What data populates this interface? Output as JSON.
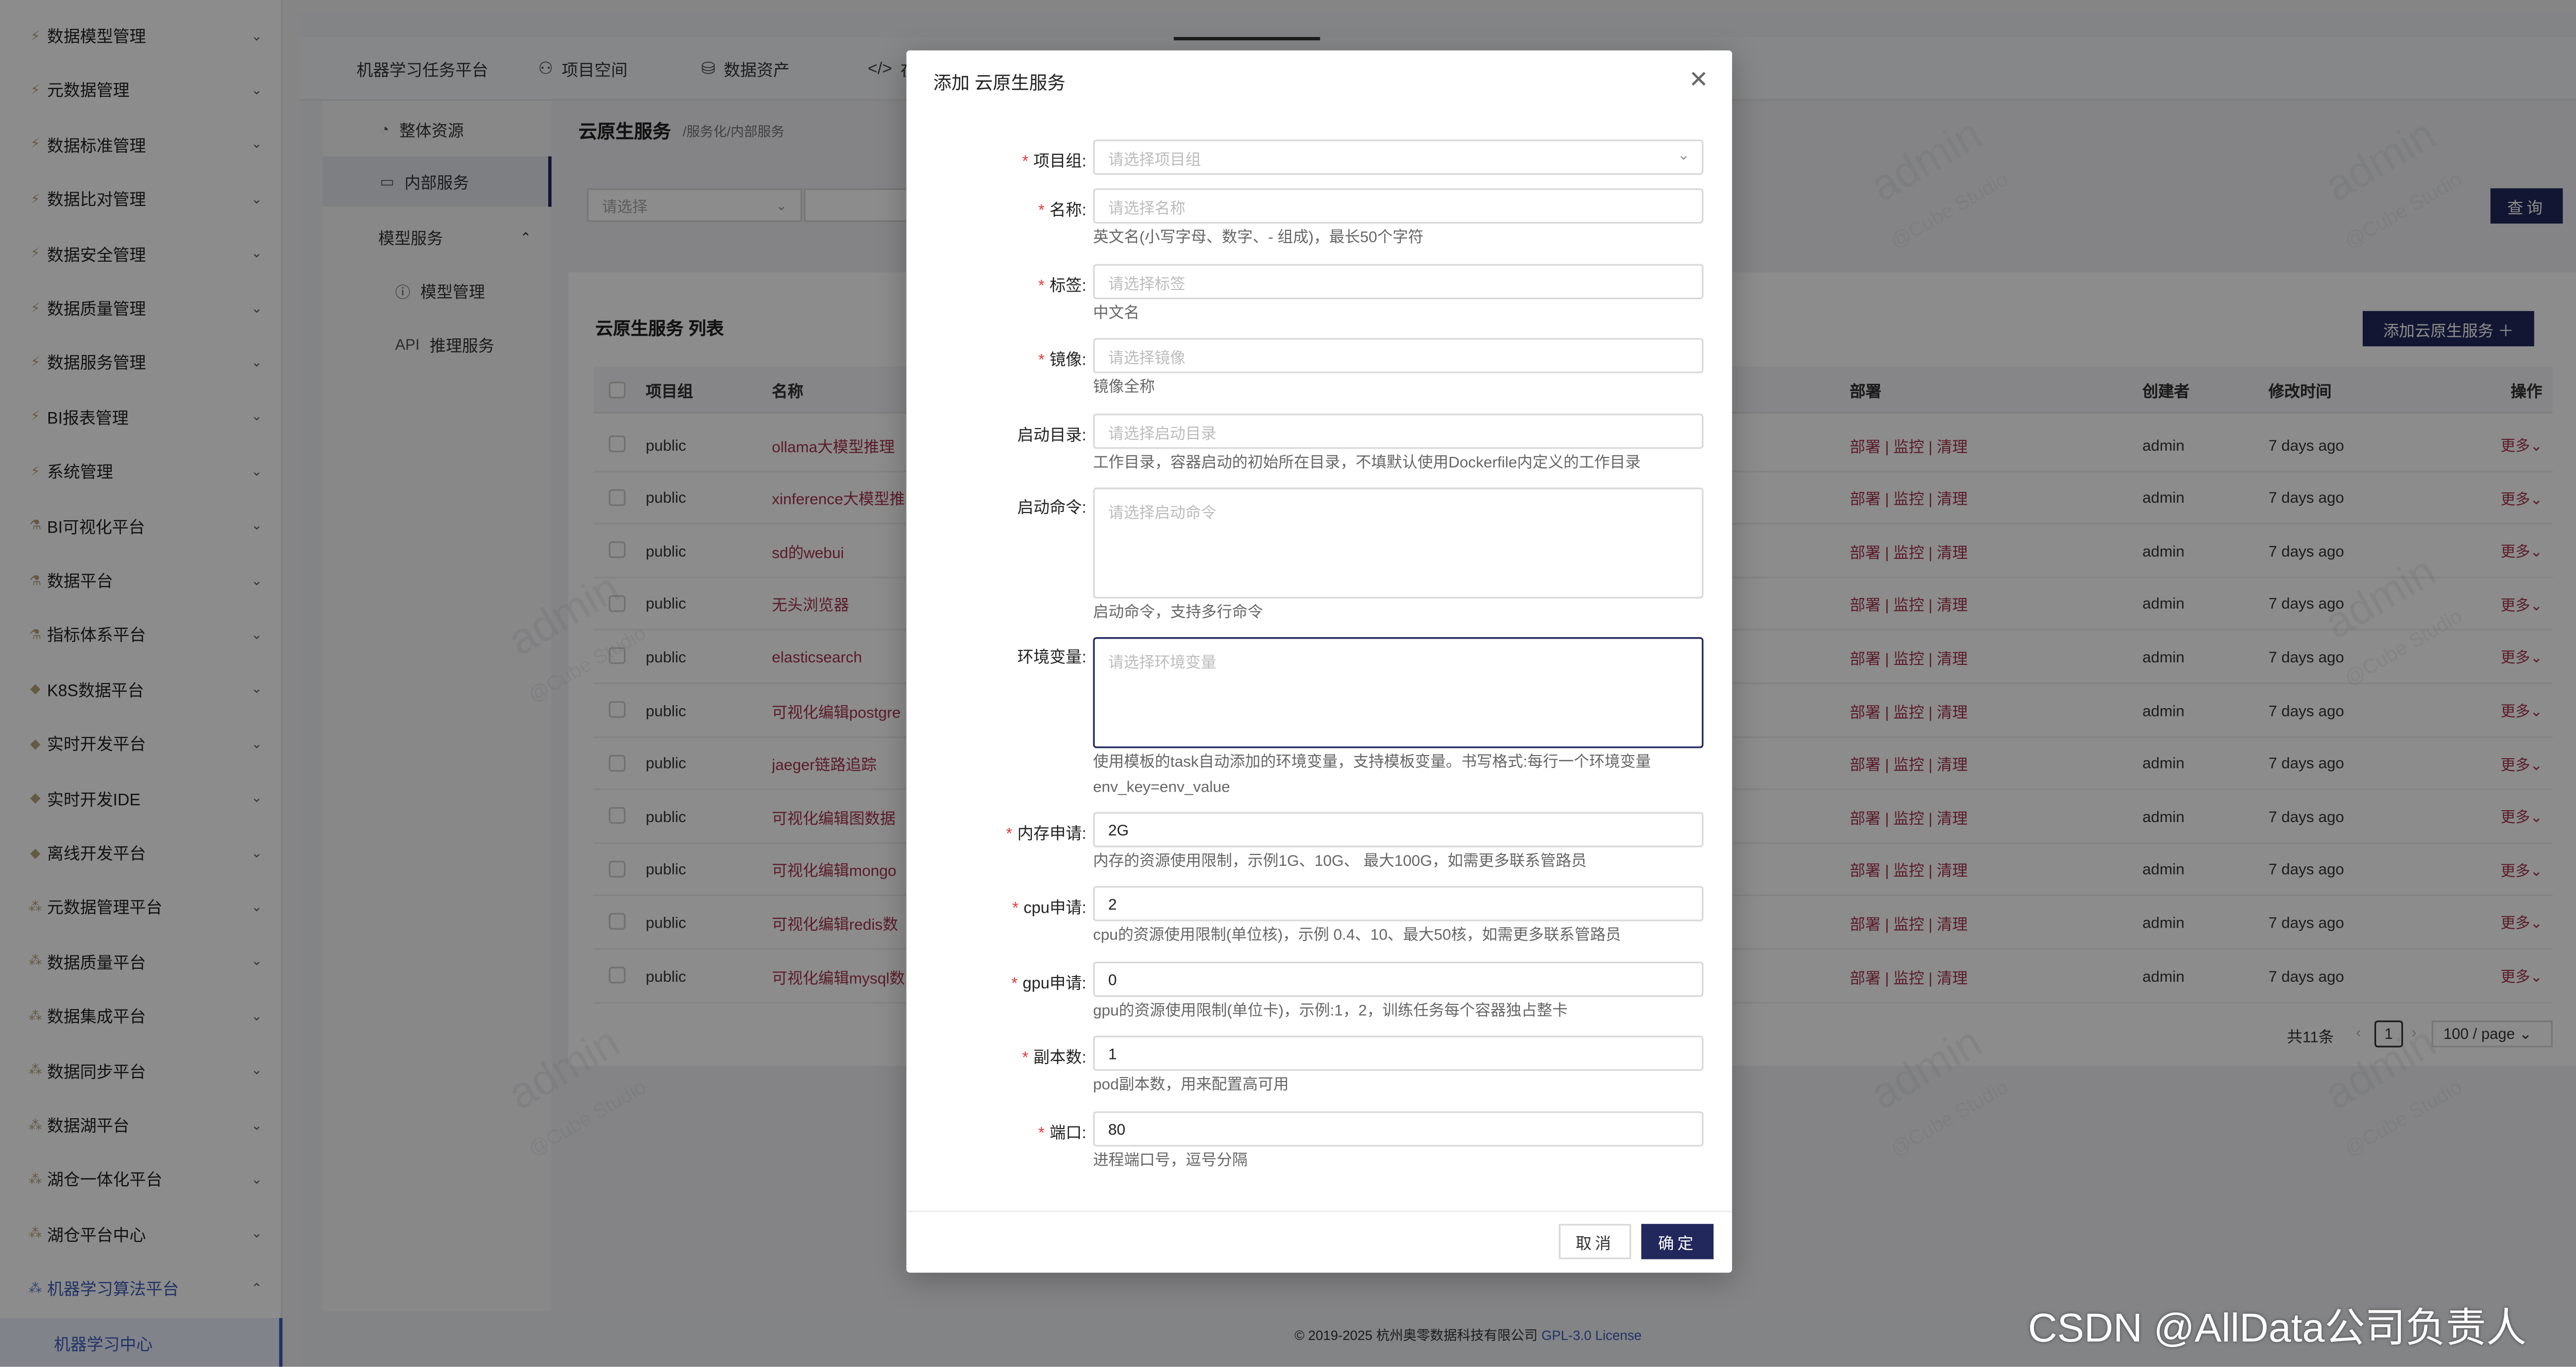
{
  "sidebar": {
    "items": [
      {
        "label": "数据模型管理",
        "icon": "bolt-icon"
      },
      {
        "label": "元数据管理",
        "icon": "bolt-icon"
      },
      {
        "label": "数据标准管理",
        "icon": "bolt-icon"
      },
      {
        "label": "数据比对管理",
        "icon": "bolt-icon"
      },
      {
        "label": "数据安全管理",
        "icon": "bolt-icon"
      },
      {
        "label": "数据质量管理",
        "icon": "bolt-icon"
      },
      {
        "label": "数据服务管理",
        "icon": "bolt-icon"
      },
      {
        "label": "BI报表管理",
        "icon": "bolt-icon"
      },
      {
        "label": "系统管理",
        "icon": "bolt-icon"
      },
      {
        "label": "BI可视化平台",
        "icon": "flask-icon"
      },
      {
        "label": "数据平台",
        "icon": "flask-icon"
      },
      {
        "label": "指标体系平台",
        "icon": "flask-icon"
      },
      {
        "label": "K8S数据平台",
        "icon": "gem-icon"
      },
      {
        "label": "实时开发平台",
        "icon": "gem-icon"
      },
      {
        "label": "实时开发IDE",
        "icon": "gem-icon"
      },
      {
        "label": "离线开发平台",
        "icon": "gem-icon"
      },
      {
        "label": "元数据管理平台",
        "icon": "cluster-icon"
      },
      {
        "label": "数据质量平台",
        "icon": "cluster-icon"
      },
      {
        "label": "数据集成平台",
        "icon": "cluster-icon"
      },
      {
        "label": "数据同步平台",
        "icon": "cluster-icon"
      },
      {
        "label": "数据湖平台",
        "icon": "cluster-icon"
      },
      {
        "label": "湖仓一体化平台",
        "icon": "cluster-icon"
      },
      {
        "label": "湖仓平台中心",
        "icon": "cluster-icon"
      },
      {
        "label": "机器学习算法平台",
        "icon": "cluster-icon"
      }
    ],
    "active_sub": "机器学习中心"
  },
  "topnav": {
    "items": [
      {
        "label": "机器学习任务平台",
        "icon": ""
      },
      {
        "label": "项目空间",
        "icon": "people-icon"
      },
      {
        "label": "数据资产",
        "icon": "database-icon"
      },
      {
        "label": "在",
        "icon": "code-icon"
      }
    ]
  },
  "subnav": {
    "items": [
      {
        "label": "整体资源",
        "icon": "dashboard-icon"
      },
      {
        "label": "内部服务",
        "icon": "monitor-icon"
      },
      {
        "label": "模型服务",
        "icon": ""
      },
      {
        "label": "模型管理",
        "icon": "info-icon"
      },
      {
        "label": "推理服务",
        "icon": "api-icon"
      }
    ]
  },
  "page": {
    "title": "云原生服务",
    "breadcrumb": "/服务化/内部服务",
    "filter_placeholder": "请选择",
    "query_label": "查询",
    "list_title": "云原生服务 列表",
    "add_label": "添加云原生服务 ＋"
  },
  "table": {
    "headers": {
      "group": "项目组",
      "name": "名称",
      "deploy": "部署",
      "creator": "创建者",
      "modified": "修改时间",
      "ops": "操作"
    },
    "rows": [
      {
        "group": "public",
        "name": "ollama大模型推理",
        "deploy": "部署 | 监控 | 清理",
        "creator": "admin",
        "modified": "7 days ago",
        "ops": "更多⌄"
      },
      {
        "group": "public",
        "name": "xinference大模型推",
        "deploy": "部署 | 监控 | 清理",
        "creator": "admin",
        "modified": "7 days ago",
        "ops": "更多⌄"
      },
      {
        "group": "public",
        "name": "sd的webui",
        "deploy": "部署 | 监控 | 清理",
        "creator": "admin",
        "modified": "7 days ago",
        "ops": "更多⌄"
      },
      {
        "group": "public",
        "name": "无头浏览器",
        "deploy": "部署 | 监控 | 清理",
        "creator": "admin",
        "modified": "7 days ago",
        "ops": "更多⌄"
      },
      {
        "group": "public",
        "name": "elasticsearch",
        "deploy": "部署 | 监控 | 清理",
        "creator": "admin",
        "modified": "7 days ago",
        "ops": "更多⌄"
      },
      {
        "group": "public",
        "name": "可视化编辑postgre",
        "deploy": "部署 | 监控 | 清理",
        "creator": "admin",
        "modified": "7 days ago",
        "ops": "更多⌄"
      },
      {
        "group": "public",
        "name": "jaeger链路追踪",
        "deploy": "部署 | 监控 | 清理",
        "creator": "admin",
        "modified": "7 days ago",
        "ops": "更多⌄"
      },
      {
        "group": "public",
        "name": "可视化编辑图数据",
        "deploy": "部署 | 监控 | 清理",
        "creator": "admin",
        "modified": "7 days ago",
        "ops": "更多⌄"
      },
      {
        "group": "public",
        "name": "可视化编辑mongo",
        "deploy": "部署 | 监控 | 清理",
        "creator": "admin",
        "modified": "7 days ago",
        "ops": "更多⌄"
      },
      {
        "group": "public",
        "name": "可视化编辑redis数",
        "deploy": "部署 | 监控 | 清理",
        "creator": "admin",
        "modified": "7 days ago",
        "ops": "更多⌄"
      },
      {
        "group": "public",
        "name": "可视化编辑mysql数",
        "deploy": "部署 | 监控 | 清理",
        "creator": "admin",
        "modified": "7 days ago",
        "ops": "更多⌄"
      }
    ]
  },
  "pager": {
    "total": "共11条",
    "page": "1",
    "size": "100 / page ⌄"
  },
  "footer": {
    "text": "© 2019-2025 杭州奥零数据科技有限公司 ",
    "license": "GPL-3.0 License"
  },
  "watermark": {
    "text": "admin",
    "sub": "@Cube Studio"
  },
  "modal": {
    "title": "添加 云原生服务",
    "fields": [
      {
        "label": "项目组:",
        "required": true,
        "placeholder": "请选择项目组",
        "value": "",
        "help": ""
      },
      {
        "label": "名称:",
        "required": true,
        "placeholder": "请选择名称",
        "value": "",
        "help": "英文名(小写字母、数字、- 组成)，最长50个字符"
      },
      {
        "label": "标签:",
        "required": true,
        "placeholder": "请选择标签",
        "value": "",
        "help": "中文名"
      },
      {
        "label": "镜像:",
        "required": true,
        "placeholder": "请选择镜像",
        "value": "",
        "help": "镜像全称"
      },
      {
        "label": "启动目录:",
        "required": false,
        "placeholder": "请选择启动目录",
        "value": "",
        "help": "工作目录，容器启动的初始所在目录，不填默认使用Dockerfile内定义的工作目录"
      },
      {
        "label": "启动命令:",
        "required": false,
        "placeholder": "请选择启动命令",
        "value": "",
        "help": "启动命令，支持多行命令"
      },
      {
        "label": "环境变量:",
        "required": false,
        "placeholder": "请选择环境变量",
        "value": "",
        "help": "使用模板的task自动添加的环境变量，支持模板变量。书写格式:每行一个环境变量env_key=env_value"
      },
      {
        "label": "内存申请:",
        "required": true,
        "placeholder": "",
        "value": "2G",
        "help": "内存的资源使用限制，示例1G、10G、 最大100G，如需更多联系管路员"
      },
      {
        "label": "cpu申请:",
        "required": true,
        "placeholder": "",
        "value": "2",
        "help": "cpu的资源使用限制(单位核)，示例 0.4、10、最大50核，如需更多联系管路员"
      },
      {
        "label": "gpu申请:",
        "required": true,
        "placeholder": "",
        "value": "0",
        "help": "gpu的资源使用限制(单位卡)，示例:1，2，训练任务每个容器独占整卡"
      },
      {
        "label": "副本数:",
        "required": true,
        "placeholder": "",
        "value": "1",
        "help": "pod副本数，用来配置高可用"
      },
      {
        "label": "端口:",
        "required": true,
        "placeholder": "",
        "value": "80",
        "help": "进程端口号，逗号分隔"
      }
    ],
    "cancel_label": "取消",
    "ok_label": "确定"
  },
  "credit": "CSDN @AllData公司负责人",
  "colors": {
    "primary": "#22285c",
    "link": "#a5334a",
    "accent": "#3e5bb8",
    "required": "#e4393c"
  }
}
